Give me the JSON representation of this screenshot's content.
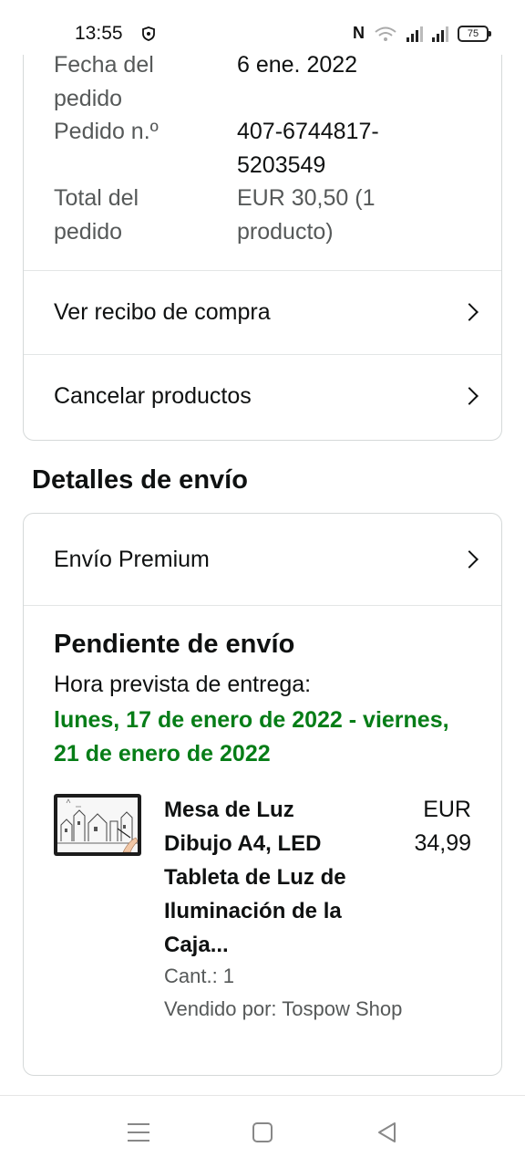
{
  "status_bar": {
    "time": "13:55",
    "battery": "75",
    "icons": [
      "shield-icon",
      "nfc-icon",
      "wifi-icon",
      "signal-icon",
      "signal-icon",
      "battery-icon"
    ]
  },
  "order_summary": {
    "date_label": "Fecha del pedido",
    "date_value": "6 ene. 2022",
    "number_label": "Pedido n.º",
    "number_value": "407-6744817-5203549",
    "total_label": "Total del pedido",
    "total_value": "EUR 30,50",
    "total_count": "(1 producto)"
  },
  "actions": {
    "receipt_label": "Ver recibo de compra",
    "cancel_label": "Cancelar productos"
  },
  "shipping": {
    "section_title": "Detalles de envío",
    "type_label": "Envío Premium",
    "status_title": "Pendiente de envío",
    "eta_label": "Hora prevista de entrega:",
    "eta_range": "lunes, 17 de enero de 2022 - viernes, 21 de enero de 2022"
  },
  "product": {
    "name": "Mesa de Luz Dibujo A4, LED Tableta de Luz de Iluminación de la Caja...",
    "price_currency": "EUR",
    "price_value": "34,99",
    "quantity": "Cant.: 1",
    "seller": "Vendido por: Tospow Shop"
  },
  "colors": {
    "delivery_green": "#067d17",
    "border": "#d5d9d9",
    "muted_text": "#565959"
  }
}
